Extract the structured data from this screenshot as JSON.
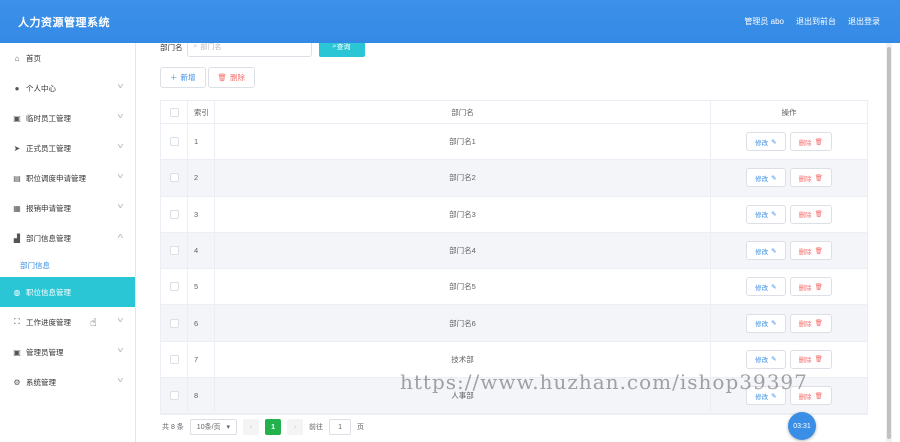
{
  "header": {
    "title": "人力资源管理系统",
    "user": "管理员 abo",
    "back_label": "退出到前台",
    "logout_label": "退出登录"
  },
  "sidebar": {
    "items": [
      {
        "label": "首页",
        "icon": "home-icon",
        "glyph": "⌂",
        "chevron": false
      },
      {
        "label": "个人中心",
        "icon": "user-icon",
        "glyph": "●",
        "chevron": true
      },
      {
        "label": "临时员工管理",
        "icon": "briefcase-icon",
        "glyph": "▣",
        "chevron": true
      },
      {
        "label": "正式员工管理",
        "icon": "send-icon",
        "glyph": "➤",
        "chevron": true
      },
      {
        "label": "职位调度申请管理",
        "icon": "bank-icon",
        "glyph": "▤",
        "chevron": true
      },
      {
        "label": "报销申请管理",
        "icon": "grid-icon",
        "glyph": "▦",
        "chevron": true
      },
      {
        "label": "部门信息管理",
        "icon": "chart-icon",
        "glyph": "▟",
        "chevron": "up"
      },
      {
        "label": "部门信息",
        "sub": true
      },
      {
        "label": "职位信息管理",
        "icon": "office-icon",
        "glyph": "◍",
        "chevron": false,
        "active": true
      },
      {
        "label": "工作进度管理",
        "icon": "fullscreen-icon",
        "glyph": "⛶",
        "chevron": true
      },
      {
        "label": "管理员管理",
        "icon": "briefcase-icon",
        "glyph": "▣",
        "chevron": true
      },
      {
        "label": "系统管理",
        "icon": "settings-icon",
        "glyph": "⚙",
        "chevron": true
      }
    ]
  },
  "search": {
    "label": "部门名",
    "placeholder": "部门名",
    "button": "查询"
  },
  "toolbar": {
    "add_label": "新增",
    "delete_label": "删除"
  },
  "table": {
    "headers": {
      "index": "索引",
      "name": "部门名",
      "actions": "操作"
    },
    "edit_label": "修改",
    "delete_label": "删除",
    "rows": [
      {
        "index": "1",
        "name": "部门名1"
      },
      {
        "index": "2",
        "name": "部门名2"
      },
      {
        "index": "3",
        "name": "部门名3"
      },
      {
        "index": "4",
        "name": "部门名4"
      },
      {
        "index": "5",
        "name": "部门名5"
      },
      {
        "index": "6",
        "name": "部门名6"
      },
      {
        "index": "7",
        "name": "技术部"
      },
      {
        "index": "8",
        "name": "人事部"
      }
    ]
  },
  "pagination": {
    "total": "共 8 条",
    "page_size": "10条/页",
    "current_page": "1",
    "goto_label": "前往",
    "goto_value": "1",
    "page_unit": "页"
  },
  "watermark": "https://www.huzhan.com/ishop39397",
  "timer": "03:31",
  "colors": {
    "header": "#3a8ee6",
    "active_menu": "#2bc6d5",
    "danger": "#f56c6c"
  }
}
